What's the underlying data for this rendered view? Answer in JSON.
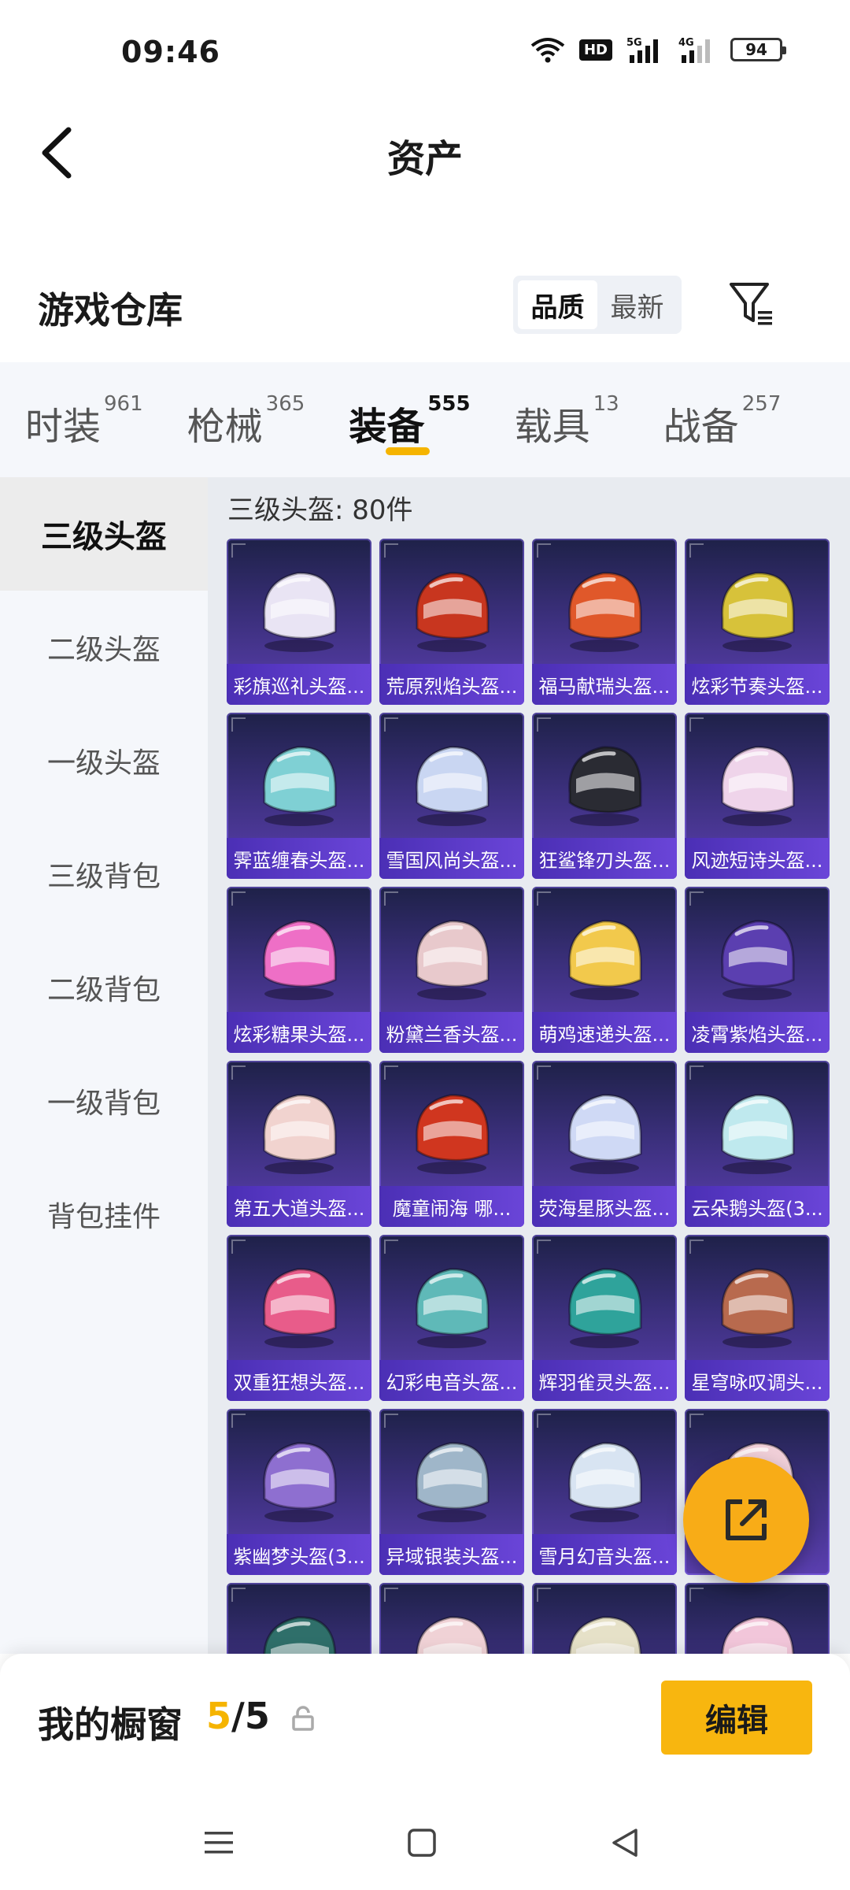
{
  "status_bar": {
    "time": "09:46",
    "hd_label": "HD",
    "signal1": "5G",
    "signal2": "4G",
    "battery": "94"
  },
  "header": {
    "title": "资产"
  },
  "section": {
    "title": "游戏仓库",
    "sort_options": [
      "品质",
      "最新"
    ],
    "active_sort": "品质"
  },
  "tabs": [
    {
      "label": "时装",
      "count": "961"
    },
    {
      "label": "枪械",
      "count": "365"
    },
    {
      "label": "装备",
      "count": "555"
    },
    {
      "label": "载具",
      "count": "13"
    },
    {
      "label": "战备",
      "count": "257"
    }
  ],
  "active_tab": "装备",
  "side_menu": [
    "三级头盔",
    "二级头盔",
    "一级头盔",
    "三级背包",
    "二级背包",
    "一级背包",
    "背包挂件"
  ],
  "active_side": "三级头盔",
  "grid": {
    "caption": "三级头盔: 80件",
    "items": [
      {
        "name": "彩旗巡礼头盔...",
        "color": "#e9e4f4"
      },
      {
        "name": "荒原烈焰头盔...",
        "color": "#c8361f"
      },
      {
        "name": "福马献瑞头盔...",
        "color": "#e0582a"
      },
      {
        "name": "炫彩节奏头盔...",
        "color": "#d7c23a"
      },
      {
        "name": "霁蓝缠春头盔...",
        "color": "#7fd0d4"
      },
      {
        "name": "雪国风尚头盔...",
        "color": "#c9d6f2"
      },
      {
        "name": "狂鲨锋刃头盔...",
        "color": "#2a2b33"
      },
      {
        "name": "风迹短诗头盔...",
        "color": "#efd4ea"
      },
      {
        "name": "炫彩糖果头盔...",
        "color": "#ee6fc6"
      },
      {
        "name": "粉黛兰香头盔...",
        "color": "#e8c9cc"
      },
      {
        "name": "萌鸡速递头盔...",
        "color": "#f2c94c"
      },
      {
        "name": "凌霄紫焰头盔...",
        "color": "#5b3fb0"
      },
      {
        "name": "第五大道头盔...",
        "color": "#f1d3cf"
      },
      {
        "name": "魔童闹海 哪...",
        "color": "#d0361f"
      },
      {
        "name": "荧海星豚头盔...",
        "color": "#cfd9f5"
      },
      {
        "name": "云朵鹅头盔(3...",
        "color": "#bfe9ee"
      },
      {
        "name": "双重狂想头盔...",
        "color": "#e85c8a"
      },
      {
        "name": "幻彩电音头盔...",
        "color": "#5fb9b8"
      },
      {
        "name": "辉羽雀灵头盔...",
        "color": "#2fa39b"
      },
      {
        "name": "星穹咏叹调头...",
        "color": "#b86a4e"
      },
      {
        "name": "紫幽梦头盔(3...",
        "color": "#8e6fd0"
      },
      {
        "name": "异域银装头盔...",
        "color": "#9fb6c9"
      },
      {
        "name": "雪月幻音头盔...",
        "color": "#d8e4f2"
      },
      {
        "name": "",
        "color": "#f0cfd8"
      },
      {
        "name": "",
        "color": "#2f6f6a"
      },
      {
        "name": "",
        "color": "#f0d2d6"
      },
      {
        "name": "",
        "color": "#e6e1c8"
      },
      {
        "name": "",
        "color": "#f2c6da"
      }
    ]
  },
  "bottom_bar": {
    "label": "我的橱窗",
    "current": "5",
    "separator": "/",
    "total": "5",
    "edit_label": "编辑"
  }
}
